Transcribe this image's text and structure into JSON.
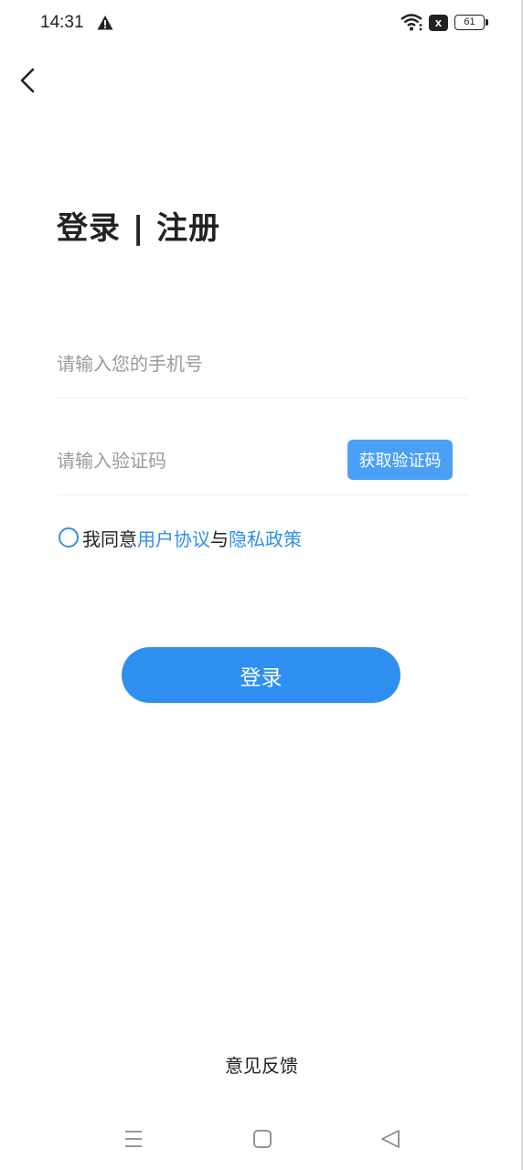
{
  "status_bar": {
    "time": "14:31",
    "battery": "61",
    "notify_x": "x",
    "icons": [
      "warning-icon",
      "wifi-icon",
      "notification-x-icon",
      "battery-icon"
    ]
  },
  "header": {
    "back_icon": "chevron-left-icon"
  },
  "title": "登录 | 注册",
  "phone": {
    "placeholder": "请输入您的手机号",
    "value": ""
  },
  "code": {
    "placeholder": "请输入验证码",
    "value": "",
    "get_code_label": "获取验证码"
  },
  "agreement": {
    "prefix": "我同意",
    "user_agreement": "用户协议",
    "conjunction": "与",
    "privacy_policy": "隐私政策",
    "checked": false
  },
  "login_label": "登录",
  "feedback_label": "意见反馈",
  "nav": {
    "icons": [
      "menu-icon",
      "home-icon",
      "back-triangle-icon"
    ]
  },
  "colors": {
    "accent": "#2f8ff0",
    "code_button": "#4aa0f5",
    "placeholder": "#9a9a9a",
    "text": "#222222",
    "divider": "#eeeeee"
  }
}
